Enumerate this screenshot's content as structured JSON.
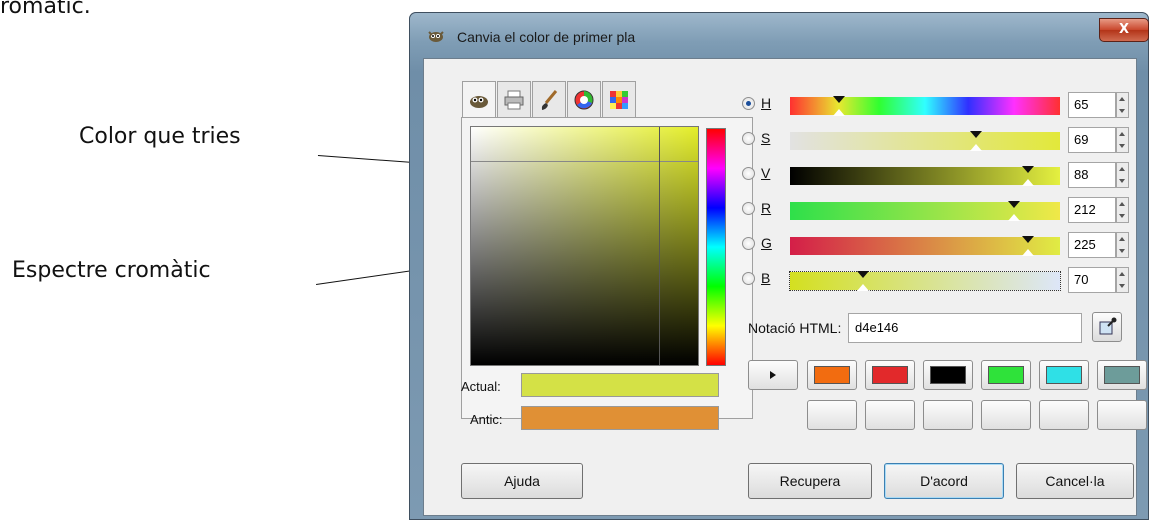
{
  "page": {
    "top_caption": "romàtic.",
    "annotation_color": "Color que tries",
    "annotation_spectrum": "Espectre cromàtic"
  },
  "window": {
    "title": "Canvia el color de primer pla",
    "close_label": "X"
  },
  "selector_tabs": [
    "wilber-icon",
    "printer-icon",
    "brush-icon",
    "color-wheel-icon",
    "palette-icon"
  ],
  "current_color": "#d4e146",
  "old_color": "#e09035",
  "preview": {
    "actual_label": "Actual:",
    "antic_label": "Antic:"
  },
  "channels": [
    {
      "key": "H",
      "label": "H",
      "value": "65",
      "selected": true
    },
    {
      "key": "S",
      "label": "S",
      "value": "69",
      "selected": false
    },
    {
      "key": "V",
      "label": "V",
      "value": "88",
      "selected": false
    },
    {
      "key": "R",
      "label": "R",
      "value": "212",
      "selected": false
    },
    {
      "key": "G",
      "label": "G",
      "value": "225",
      "selected": false
    },
    {
      "key": "B",
      "label": "B",
      "value": "70",
      "selected": false
    }
  ],
  "html_notation": {
    "label": "Notació HTML:",
    "value": "d4e146"
  },
  "history_colors": [
    "#f26c10",
    "#e2292b",
    "#000000",
    "#2fe23a",
    "#2fe0e6",
    "#6d9c9a"
  ],
  "empty_slots": 6,
  "buttons": {
    "help": "Ajuda",
    "reset": "Recupera",
    "ok": "D'acord",
    "cancel": "Cancel·la"
  }
}
